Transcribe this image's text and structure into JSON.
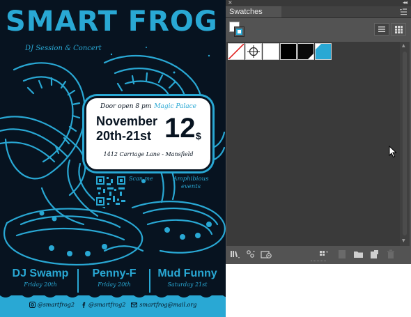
{
  "poster": {
    "title": "SMART FROG",
    "subtitle": "DJ Session & Concert",
    "door_text": "Door open 8 pm",
    "venue": "Magic Palace",
    "date_month": "November",
    "date_days": "20th-21st",
    "price": "12",
    "currency": "$",
    "address": "1412 Carriage Lane - Mansfield",
    "scan_label": "Scan me",
    "events_label": "Amphibious events",
    "acts": [
      {
        "name": "DJ Swamp",
        "day": "Friday 20th"
      },
      {
        "name": "Penny-F",
        "day": "Friday 20th"
      },
      {
        "name": "Mud Funny",
        "day": "Saturday 21st"
      }
    ],
    "socials": {
      "instagram": "@smartfrog2",
      "facebook": "@smartfrog2",
      "email": "smartfrog@mail.org"
    },
    "colors": {
      "accent": "#29a8d4",
      "background": "#071320"
    }
  },
  "panel": {
    "tab_label": "Swatches",
    "swatches": [
      {
        "name": "None",
        "color": "#ffffff"
      },
      {
        "name": "Registration",
        "color": "#ffffff"
      },
      {
        "name": "White",
        "color": "#ffffff"
      },
      {
        "name": "Black",
        "color": "#000000"
      },
      {
        "name": "Rich Black",
        "color": "#0a0a0a"
      },
      {
        "name": "Blue",
        "color": "#29a8d4"
      }
    ],
    "colors": {
      "panel_bg": "#535353",
      "list_bg": "#3a3a3a"
    }
  }
}
